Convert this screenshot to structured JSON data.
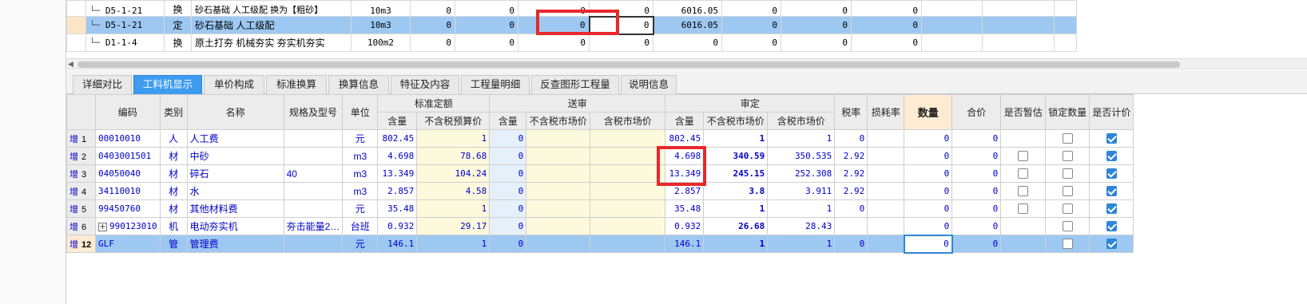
{
  "top_rows": [
    {
      "code": "D5-1-21",
      "type": "换",
      "name": "砂石基础 人工级配 换为【粗砂】",
      "unit": "10m3",
      "v1": "0",
      "v2": "0",
      "v3": "0",
      "v4": "0",
      "v5": "6016.05",
      "v6": "0",
      "v7": "0",
      "v8": "0"
    },
    {
      "code": "D5-1-21",
      "type": "定",
      "name": "砂石基础 人工级配",
      "unit": "10m3",
      "v1": "0",
      "v2": "0",
      "v3": "0",
      "v4": "0",
      "v5": "6016.05",
      "v6": "0",
      "v7": "0",
      "v8": "0"
    },
    {
      "code": "D1-1-4",
      "type": "换",
      "name": "原土打夯 机械夯实 夯实机夯实",
      "unit": "100m2",
      "v1": "0",
      "v2": "0",
      "v3": "0",
      "v4": "0",
      "v5": "0",
      "v6": "0",
      "v7": "0",
      "v8": "0"
    }
  ],
  "tabs": [
    "详细对比",
    "工料机显示",
    "单价构成",
    "标准换算",
    "换算信息",
    "特征及内容",
    "工程量明细",
    "反查图形工程量",
    "说明信息"
  ],
  "headers": {
    "code": "编码",
    "category": "类别",
    "name": "名称",
    "spec": "规格及型号",
    "unit": "单位",
    "std_quota": "标准定额",
    "sent": "送审",
    "approved": "审定",
    "tax_rate": "税率",
    "loss_rate": "损耗率",
    "quantity": "数量",
    "total": "合价",
    "is_estimate": "是否暂估",
    "lock_qty": "锁定数量",
    "is_priced": "是否计价",
    "content": "含量",
    "excl_tax_budget": "不含税预算价",
    "excl_tax_market": "不含税市场价",
    "incl_tax_market": "含税市场价"
  },
  "rows": [
    {
      "prefix": "增",
      "no": "1",
      "code": "00010010",
      "cat": "人",
      "name": "人工费",
      "spec": "",
      "unit": "元",
      "std_qty": "802.45",
      "std_price": "1",
      "s_qty": "0",
      "s_ex": "",
      "s_in": "",
      "a_qty": "802.45",
      "a_ex": "1",
      "a_in": "1",
      "tax": "0",
      "loss": "",
      "qty": "0",
      "total": "0",
      "est": false,
      "est_show": false,
      "lock": false,
      "priced": true
    },
    {
      "prefix": "增",
      "no": "2",
      "code": "0403001501",
      "cat": "材",
      "name": "中砂",
      "spec": "",
      "unit": "m3",
      "std_qty": "4.698",
      "std_price": "78.68",
      "s_qty": "0",
      "s_ex": "",
      "s_in": "",
      "a_qty": "4.698",
      "a_ex": "340.59",
      "a_in": "350.535",
      "tax": "2.92",
      "loss": "",
      "qty": "0",
      "total": "0",
      "est": false,
      "est_show": true,
      "lock": false,
      "priced": true
    },
    {
      "prefix": "增",
      "no": "3",
      "code": "04050040",
      "cat": "材",
      "name": "碎石",
      "spec": "40",
      "unit": "m3",
      "std_qty": "13.349",
      "std_price": "104.24",
      "s_qty": "0",
      "s_ex": "",
      "s_in": "",
      "a_qty": "13.349",
      "a_ex": "245.15",
      "a_in": "252.308",
      "tax": "2.92",
      "loss": "",
      "qty": "0",
      "total": "0",
      "est": false,
      "est_show": true,
      "lock": false,
      "priced": true
    },
    {
      "prefix": "增",
      "no": "4",
      "code": "34110010",
      "cat": "材",
      "name": "水",
      "spec": "",
      "unit": "m3",
      "std_qty": "2.857",
      "std_price": "4.58",
      "s_qty": "0",
      "s_ex": "",
      "s_in": "",
      "a_qty": "2.857",
      "a_ex": "3.8",
      "a_in": "3.911",
      "tax": "2.92",
      "loss": "",
      "qty": "0",
      "total": "0",
      "est": false,
      "est_show": true,
      "lock": false,
      "priced": true
    },
    {
      "prefix": "增",
      "no": "5",
      "code": "99450760",
      "cat": "材",
      "name": "其他材料费",
      "spec": "",
      "unit": "元",
      "std_qty": "35.48",
      "std_price": "1",
      "s_qty": "0",
      "s_ex": "",
      "s_in": "",
      "a_qty": "35.48",
      "a_ex": "1",
      "a_in": "1",
      "tax": "0",
      "loss": "",
      "qty": "0",
      "total": "0",
      "est": false,
      "est_show": true,
      "lock": false,
      "priced": true
    },
    {
      "prefix": "增",
      "no": "6",
      "code": "990123010",
      "cat": "机",
      "name": "电动夯实机",
      "spec": "夯击能量2…",
      "unit": "台班",
      "std_qty": "0.932",
      "std_price": "29.17",
      "s_qty": "0",
      "s_ex": "",
      "s_in": "",
      "a_qty": "0.932",
      "a_ex": "26.68",
      "a_in": "28.43",
      "tax": "",
      "loss": "",
      "qty": "0",
      "total": "0",
      "est": false,
      "est_show": false,
      "lock": false,
      "priced": true,
      "expandable": true
    },
    {
      "prefix": "增",
      "no": "12",
      "code": "GLF",
      "cat": "管",
      "name": "管理费",
      "spec": "",
      "unit": "元",
      "std_qty": "146.1",
      "std_price": "1",
      "s_qty": "0",
      "s_ex": "",
      "s_in": "",
      "a_qty": "146.1",
      "a_ex": "1",
      "a_in": "1",
      "tax": "0",
      "loss": "",
      "qty": "0",
      "total": "0",
      "est": false,
      "est_show": false,
      "lock": false,
      "priced": true,
      "selected": true
    }
  ],
  "colors": {
    "accent": "#3d9cf0",
    "selected_row": "#9dc8f2",
    "highlight_box": "#e8282c",
    "data_text": "#0000c8"
  }
}
